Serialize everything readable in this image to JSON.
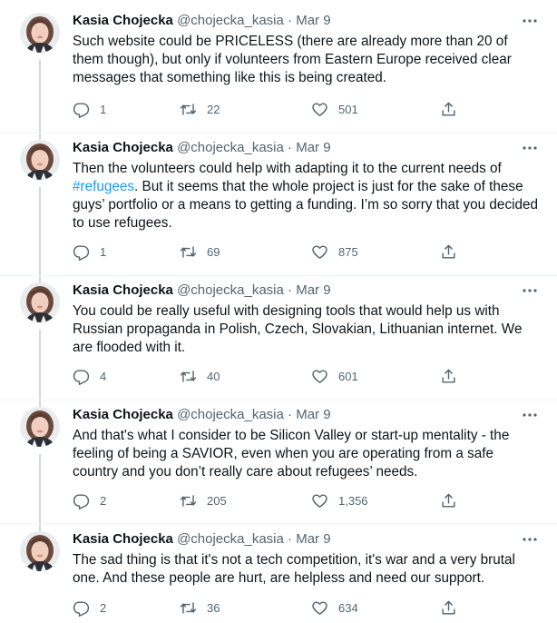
{
  "tweets": [
    {
      "author": "Kasia Chojecka",
      "handle": "@chojecka_kasia",
      "separator": "·",
      "date": "Mar 9",
      "text_before": "Such website could be PRICELESS (there are already more than 20 of them though), but only if volunteers from Eastern Europe received clear messages that something like this is being created.",
      "hashtag": "",
      "text_after": "",
      "replies": "1",
      "retweets": "22",
      "likes": "501"
    },
    {
      "author": "Kasia Chojecka",
      "handle": "@chojecka_kasia",
      "separator": "·",
      "date": "Mar 9",
      "text_before": "Then the volunteers could help with adapting it to the current needs of ",
      "hashtag": "#refugees",
      "text_after": ". But it seems that the whole project is just for the sake of these guys’ portfolio or a means to getting a funding. I’m so sorry that you decided to use refugees.",
      "replies": "1",
      "retweets": "69",
      "likes": "875"
    },
    {
      "author": "Kasia Chojecka",
      "handle": "@chojecka_kasia",
      "separator": "·",
      "date": "Mar 9",
      "text_before": "You could be really useful with designing tools that would help us with Russian propaganda in Polish, Czech, Slovakian, Lithuanian internet. We are flooded with it.",
      "hashtag": "",
      "text_after": "",
      "replies": "4",
      "retweets": "40",
      "likes": "601"
    },
    {
      "author": "Kasia Chojecka",
      "handle": "@chojecka_kasia",
      "separator": "·",
      "date": "Mar 9",
      "text_before": "And that's what I consider to be Silicon Valley or start-up mentality - the feeling of being a SAVIOR, even when you are operating from a safe country and you don’t really care about refugees’ needs.",
      "hashtag": "",
      "text_after": "",
      "replies": "2",
      "retweets": "205",
      "likes": "1,356"
    },
    {
      "author": "Kasia Chojecka",
      "handle": "@chojecka_kasia",
      "separator": "·",
      "date": "Mar 9",
      "text_before": "The sad thing is that it's not a tech competition, it's war and a very brutal one. And these people are hurt, are helpless and need our support.",
      "hashtag": "",
      "text_after": "",
      "replies": "2",
      "retweets": "36",
      "likes": "634"
    }
  ],
  "icons": {
    "reply": "reply-icon",
    "retweet": "retweet-icon",
    "like": "heart-icon",
    "share": "share-icon",
    "more": "more-icon",
    "avatar": "avatar"
  },
  "colors": {
    "text": "#0f1419",
    "secondary": "#536471",
    "hashtag": "#1d9bf0",
    "connector": "#cfd9de",
    "separator": "#eff3f4"
  }
}
